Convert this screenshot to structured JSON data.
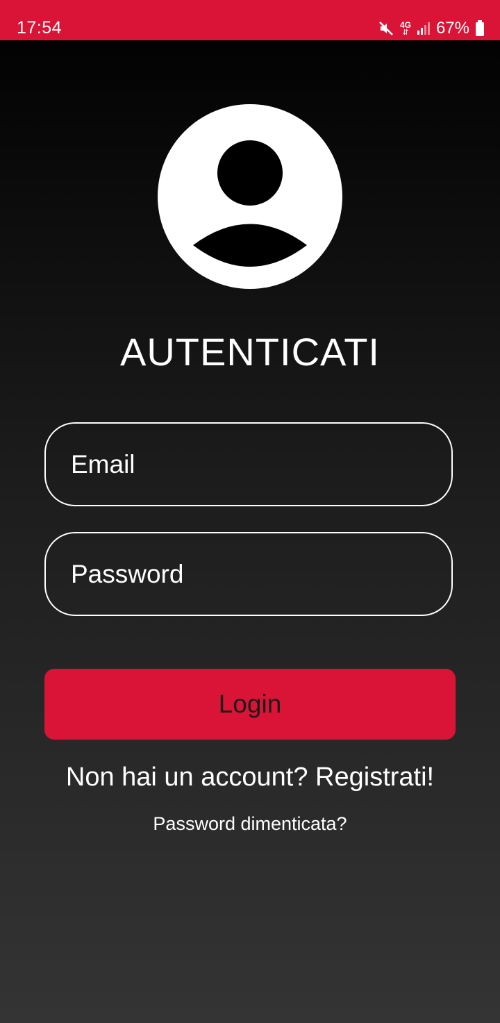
{
  "status_bar": {
    "time": "17:54",
    "network": "4G",
    "battery": "67%",
    "accent_color": "#d91436",
    "icons": [
      "mute-icon",
      "network-4g-icon",
      "signal-icon",
      "battery-icon"
    ]
  },
  "screen": {
    "avatar_icon": "user-avatar-icon",
    "title": "AUTENTICATI",
    "email_placeholder": "Email",
    "password_placeholder": "Password",
    "login_label": "Login",
    "register_link": "Non hai un account? Registrati!",
    "forgot_link": "Password dimenticata?"
  }
}
